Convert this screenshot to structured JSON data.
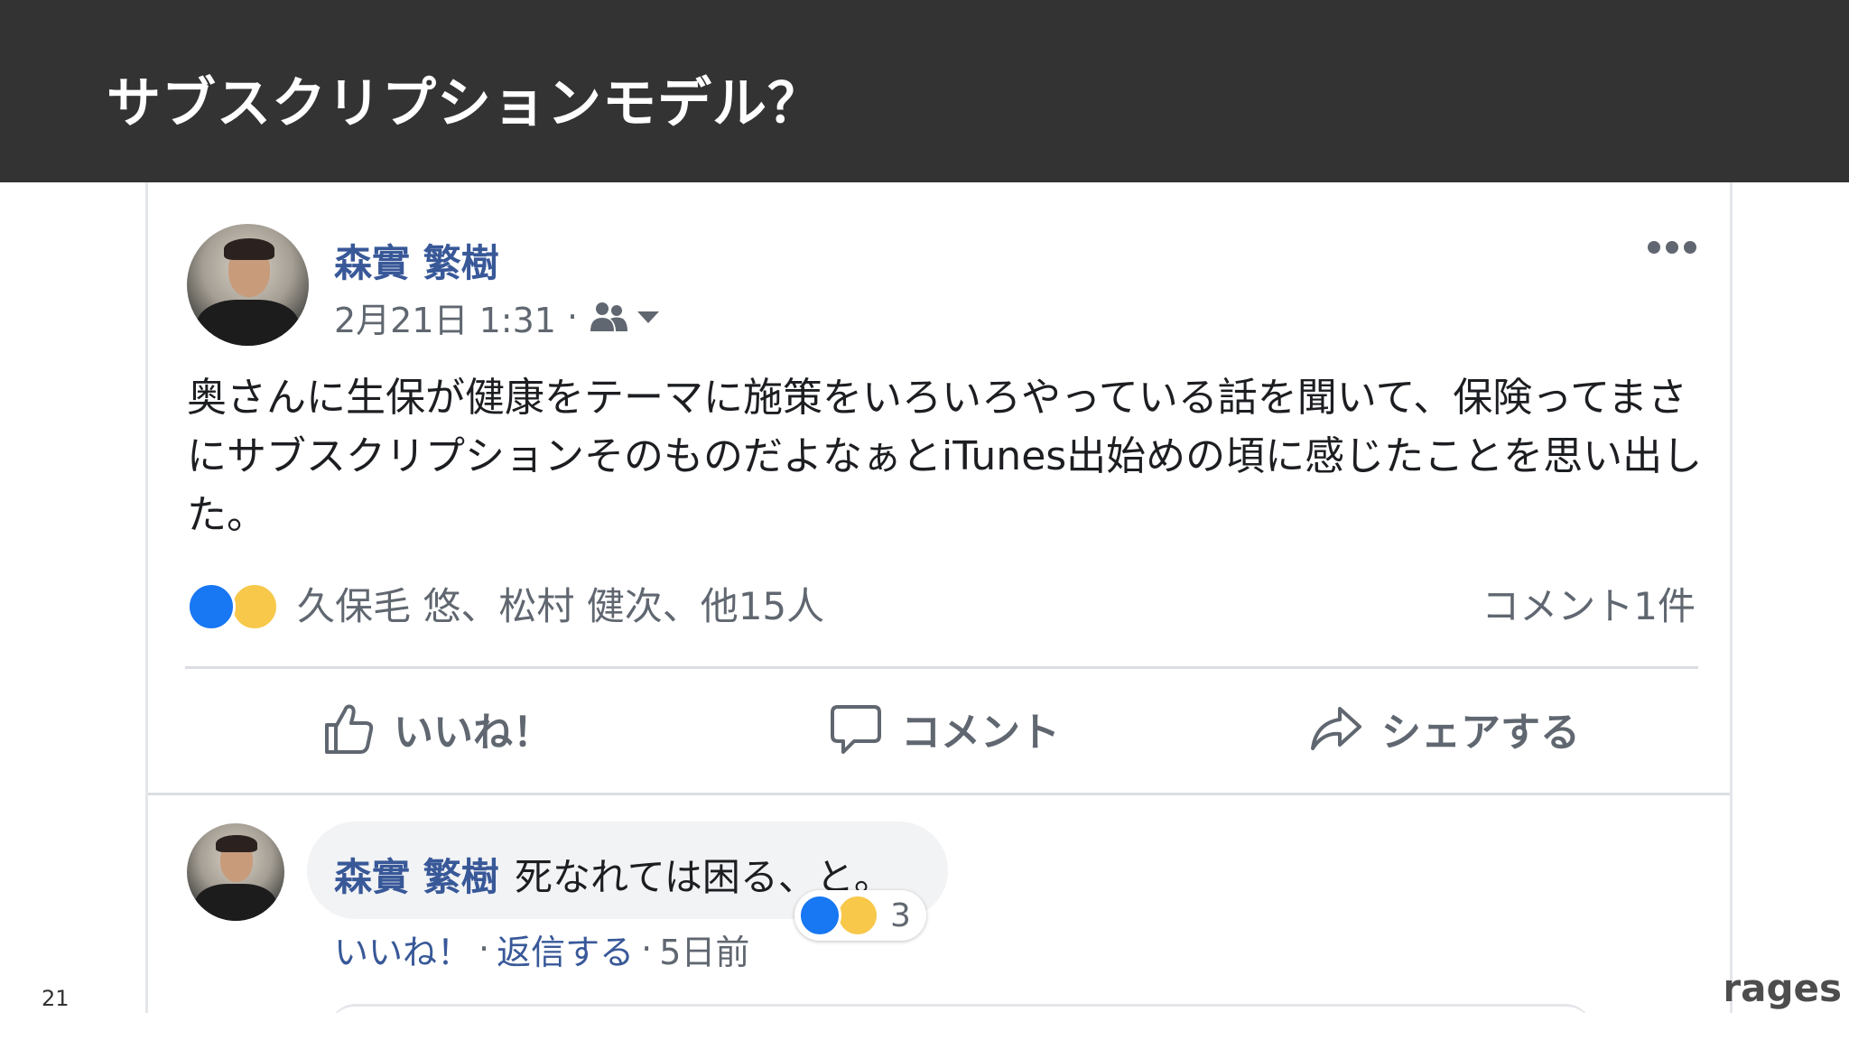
{
  "slide": {
    "title": "サブスクリプションモデル？",
    "page_number": "21",
    "footer_logo_text": "rages"
  },
  "post": {
    "author": "森實 繁樹",
    "date": "2月21日 1:31",
    "meta_separator": "·",
    "audience_icon": "friends-icon",
    "body": "奥さんに生保が健康をテーマに施策をいろいろやっている話を聞いて、保険ってまさにサブスクリプションそのものだよなぁとiTunes出始めの頃に感じたことを思い出した。",
    "reactions": {
      "icons": [
        "like-icon",
        "wow-icon"
      ],
      "names": "久保毛 悠、松村 健次、他15人",
      "comment_count": "コメント1件"
    },
    "actions": {
      "like": "いいね！",
      "comment": "コメント",
      "share": "シェアする"
    }
  },
  "comment": {
    "author": "森實 繁樹",
    "text": "死なれては困る、と。",
    "like_link": "いいね！",
    "reply_link": "返信する",
    "separator": "·",
    "time": "5日前",
    "reaction_count": "3",
    "reaction_icons": [
      "like-icon",
      "haha-icon"
    ]
  },
  "colors": {
    "header_bg": "#333333",
    "name_link": "#385898",
    "secondary_text": "#606770",
    "like_blue": "#1877f2",
    "emoji_yellow": "#f7c84a"
  }
}
